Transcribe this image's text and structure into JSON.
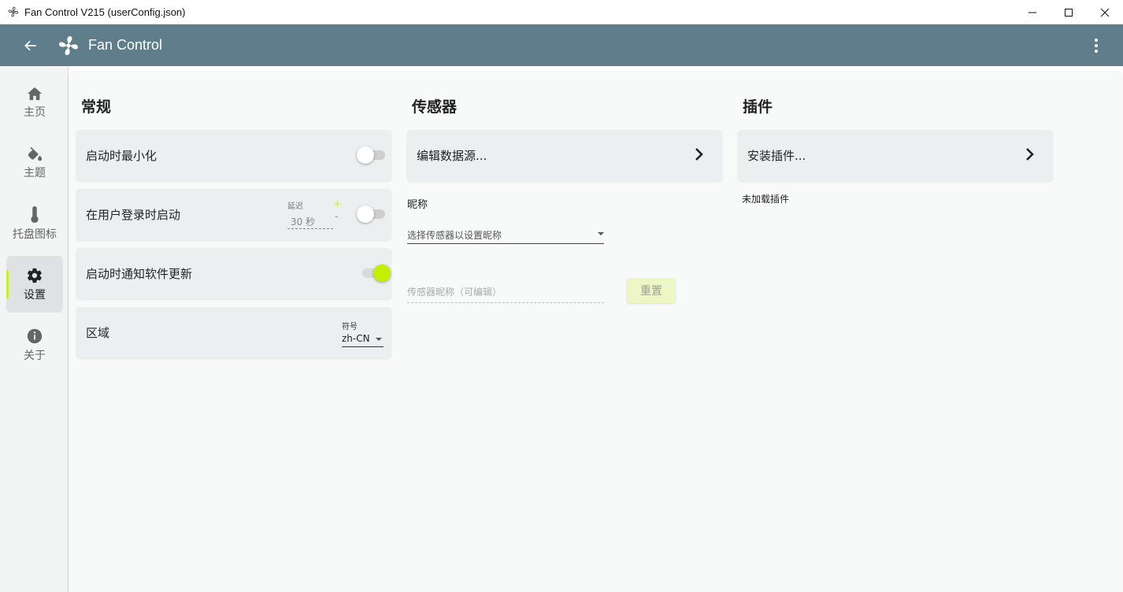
{
  "window": {
    "title": "Fan Control V215 (userConfig.json)",
    "icons": {
      "app": "fan-outline-icon",
      "minimize": "minimize-icon",
      "maximize": "maximize-icon",
      "close": "close-icon"
    }
  },
  "appbar": {
    "title": "Fan Control",
    "icons": {
      "back": "arrow-left-icon",
      "logo": "fan-icon",
      "menu": "more-vertical-icon"
    },
    "color": "#607d8b"
  },
  "sidebar": {
    "items": [
      {
        "label": "主页",
        "icon": "home-icon"
      },
      {
        "label": "主题",
        "icon": "paint-bucket-icon"
      },
      {
        "label": "托盘图标",
        "icon": "thermometer-icon"
      },
      {
        "label": "设置",
        "icon": "gear-icon",
        "active": true
      },
      {
        "label": "关于",
        "icon": "info-icon"
      }
    ]
  },
  "general": {
    "title": "常规",
    "minimize_on_start": {
      "label": "启动时最小化",
      "enabled": false
    },
    "start_on_login": {
      "label": "在用户登录时启动",
      "enabled": false,
      "delay_label": "延迟",
      "delay_value": "30 秒",
      "plus": "+",
      "minus": "-"
    },
    "notify_updates": {
      "label": "启动时通知软件更新",
      "enabled": true
    },
    "region": {
      "label": "区域",
      "select_label": "符号",
      "value": "zh-CN"
    }
  },
  "sensors": {
    "title": "传感器",
    "edit_sources": "编辑数据源...",
    "nickname_label": "昵称",
    "select_placeholder": "选择传感器以设置昵称",
    "nickname_placeholder": "传感器昵称（可编辑）",
    "reset": "重置"
  },
  "plugins": {
    "title": "插件",
    "install": "安装插件...",
    "none_loaded": "未加载插件"
  },
  "colors": {
    "accent": "#c4f000",
    "card": "#eceff0",
    "background": "#f8faf9"
  }
}
